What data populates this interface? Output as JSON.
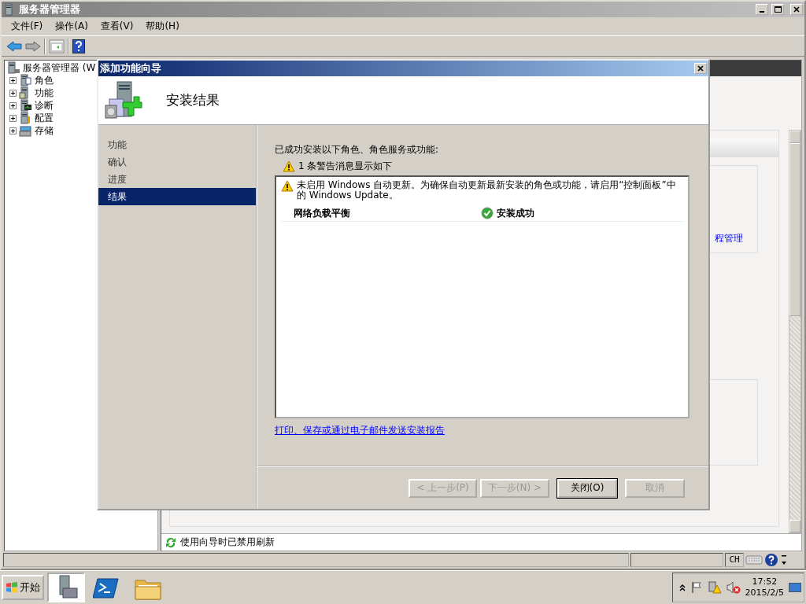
{
  "window": {
    "title": "服务器管理器"
  },
  "menu": [
    "文件(F)",
    "操作(A)",
    "查看(V)",
    "帮助(H)"
  ],
  "tree": {
    "root": "服务器管理器 (W",
    "children": [
      {
        "label": "角色",
        "kind": "roles",
        "expanded": false
      },
      {
        "label": "功能",
        "kind": "features",
        "expanded": false
      },
      {
        "label": "诊断",
        "kind": "diagnostics",
        "expanded": false
      },
      {
        "label": "配置",
        "kind": "configuration",
        "expanded": false
      },
      {
        "label": "存储",
        "kind": "storage",
        "expanded": false
      }
    ]
  },
  "right_panel": {
    "link_fragment": "程管理",
    "status": "使用向导时已禁用刷新"
  },
  "status_bar": {
    "language": "CH"
  },
  "dialog": {
    "title": "添加功能向导",
    "heading": "安装结果",
    "steps": [
      {
        "label": "功能",
        "selected": false
      },
      {
        "label": "确认",
        "selected": false
      },
      {
        "label": "进度",
        "selected": false
      },
      {
        "label": "结果",
        "selected": true
      }
    ],
    "intro": "已成功安装以下角色、角色服务或功能:",
    "warning_summary": "1 条警告消息显示如下",
    "warning": "未启用 Windows 自动更新。为确保自动更新最新安装的角色或功能，请启用“控制面板”中的 Windows Update。",
    "results": [
      {
        "name": "网络负载平衡",
        "status": "安装成功"
      }
    ],
    "report_link": "打印、保存或通过电子邮件发送安装报告",
    "buttons": [
      {
        "label": "< 上一步(P)",
        "disabled": true,
        "default": false
      },
      {
        "label": "下一步(N) >",
        "disabled": true,
        "default": false
      },
      {
        "label": "关闭(O)",
        "disabled": false,
        "default": true
      },
      {
        "label": "取消",
        "disabled": true,
        "default": false
      }
    ]
  },
  "taskbar": {
    "start": "开始",
    "apps": [
      {
        "kind": "server-manager",
        "selected": true
      },
      {
        "kind": "powershell",
        "selected": false
      },
      {
        "kind": "explorer",
        "selected": false
      }
    ],
    "clock": {
      "time": "17:52",
      "date": "2015/2/5"
    }
  }
}
